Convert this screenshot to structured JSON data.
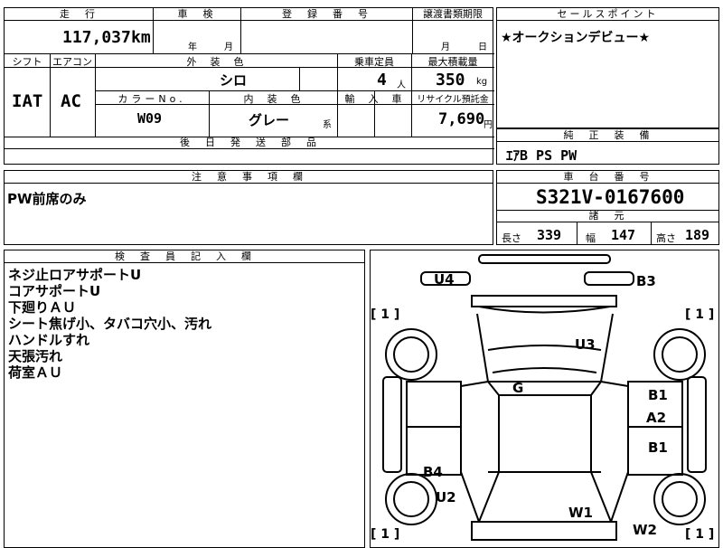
{
  "top_table": {
    "mileage_header": "走　行",
    "mileage_value": "117,037",
    "mileage_unit": "km",
    "inspection_header": "車　検",
    "inspection_year": "年",
    "inspection_month": "月",
    "registration_header": "登　録　番　号",
    "transfer_header": "譲渡書類期限",
    "transfer_month": "月",
    "transfer_day": "日",
    "shift_header": "シフト",
    "shift_value": "IAT",
    "ac_header": "エアコン",
    "ac_value": "AC",
    "exterior_color_header": "外　装　色",
    "exterior_color_value": "シロ",
    "capacity_header": "乗車定員",
    "capacity_value": "4",
    "capacity_unit": "人",
    "max_load_header": "最大積載量",
    "max_load_value": "350",
    "max_load_unit": "kg",
    "color_no_header": "カラーNo.",
    "color_no_value": "W09",
    "interior_color_header": "内　装　色",
    "interior_color_value": "グレー",
    "interior_color_suffix": "系",
    "import_header": "輸　入　車",
    "recycle_header": "リサイクル預託金",
    "recycle_value": "7,690",
    "recycle_unit": "円",
    "later_parts_header": "後　日　発　送　部　品"
  },
  "sales_point": {
    "header": "セールスポイント",
    "text": "★オークションデビュー★"
  },
  "standard_equipment": {
    "header": "純　正　装　備",
    "text": "ｴｱB PS PW"
  },
  "notes": {
    "header": "注　意　事　項　欄",
    "text": "PW前席のみ"
  },
  "chassis": {
    "header": "車　台　番　号",
    "number": "S321V-0167600",
    "specs_header": "諸　元",
    "length_label": "長さ",
    "length_value": "339",
    "width_label": "幅",
    "width_value": "147",
    "height_label": "高さ",
    "height_value": "189"
  },
  "inspector": {
    "header": "検　査　員　記　入　欄",
    "lines": [
      "ネジ止ロアサポートU",
      "コアサポートU",
      "下廻りＡＵ",
      "シート焦げ小、タバコ穴小、汚れ",
      "ハンドルすれ",
      "天張汚れ",
      "荷室ＡＵ"
    ]
  },
  "diagram": {
    "labels": {
      "u4": "U4",
      "b3": "B3",
      "u3": "U3",
      "g": "G",
      "b1_top": "B1",
      "a2": "A2",
      "b1_bottom": "B1",
      "b4": "B4",
      "u2": "U2",
      "w1": "W1",
      "w2": "W2"
    },
    "tire_marks": {
      "front_left": "[ 1 ]",
      "front_right": "[ 1 ]",
      "rear_left": "[ 1 ]",
      "rear_right": "[ 1 ]"
    }
  }
}
